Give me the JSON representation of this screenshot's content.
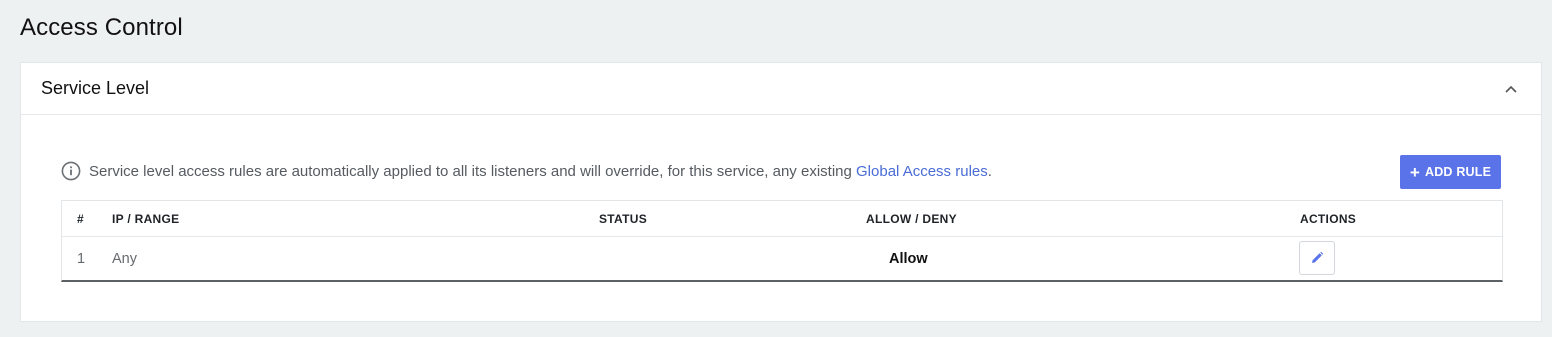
{
  "page": {
    "title": "Access Control"
  },
  "panel": {
    "title": "Service Level",
    "collapse_icon": "chevron-up-icon"
  },
  "info": {
    "icon": "info-icon",
    "text": "Service level access rules are automatically applied to all its listeners and will override, for this service, any existing ",
    "link_text": "Global Access rules",
    "suffix": "."
  },
  "toolbar": {
    "add_rule_label": "ADD RULE",
    "add_rule_icon": "plus-icon"
  },
  "table": {
    "columns": [
      "#",
      "IP / RANGE",
      "STATUS",
      "ALLOW / DENY",
      "ACTIONS"
    ],
    "rows": [
      {
        "num": "1",
        "ip_range": "Any",
        "status": "",
        "allow_deny": "Allow",
        "action_icon": "pencil-icon"
      }
    ]
  },
  "colors": {
    "accent": "#5b73e8",
    "link": "#4a6cd4",
    "background": "#eef1f2"
  }
}
